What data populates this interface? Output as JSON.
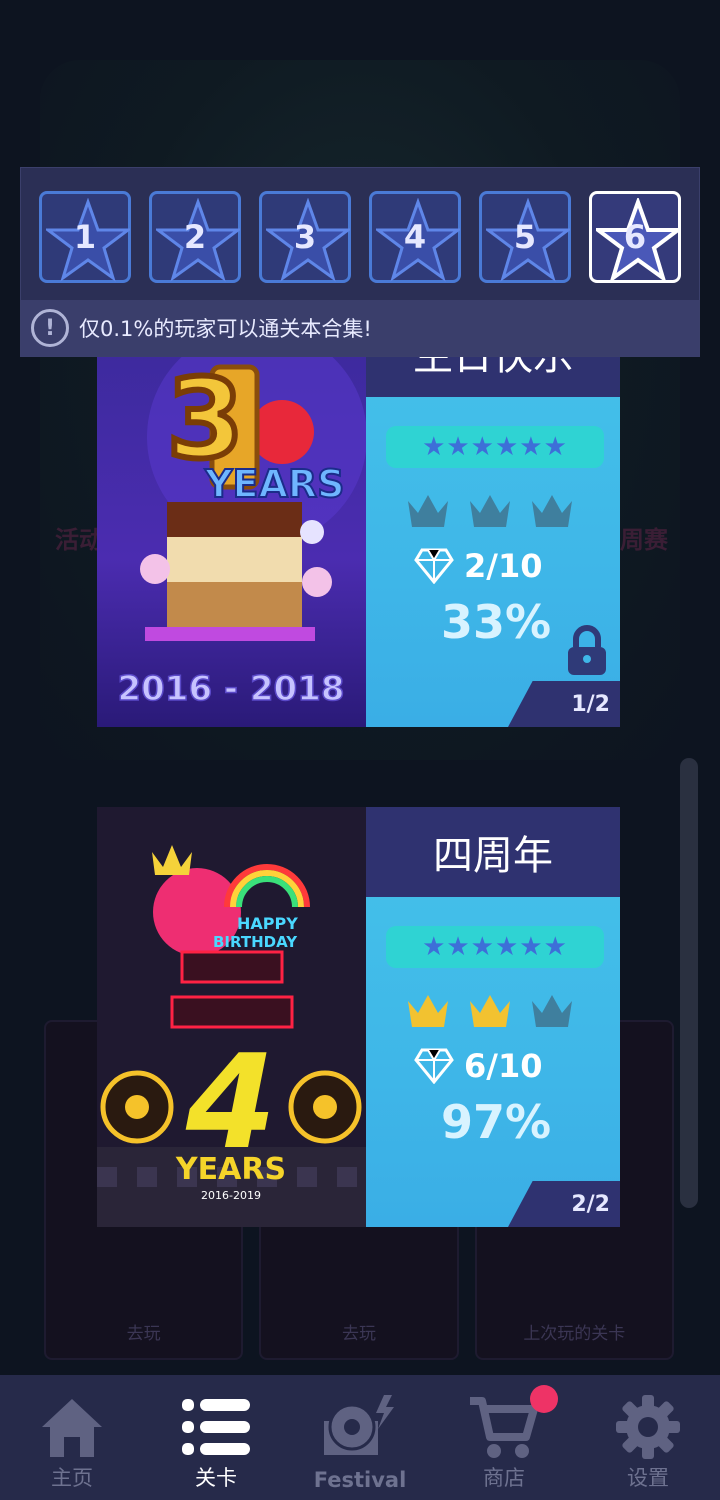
{
  "background": {
    "left_event_label": "活动",
    "right_event_label": "周赛",
    "cards": [
      {
        "button": "去玩"
      },
      {
        "button": "去玩"
      },
      {
        "button": "上次玩的关卡"
      }
    ]
  },
  "star_selector": {
    "levels": [
      "1",
      "2",
      "3",
      "4",
      "5",
      "6"
    ],
    "selected": "6",
    "notice": "仅0.1%的玩家可以通关本合集!"
  },
  "cards": [
    {
      "title": "生日快乐",
      "art_years_label": "YEARS",
      "art_big_number": "3",
      "art_date_range": "2016 - 2018",
      "stars": "★★★★★★",
      "crowns_earned": 0,
      "crowns_total": 3,
      "gems": "2/10",
      "percent": "33%",
      "locked": true,
      "page": "1/2"
    },
    {
      "title": "四周年",
      "art_birthday_label_1": "HAPPY",
      "art_birthday_label_2": "BIRTHDAY",
      "art_big_number": "4",
      "art_years_label": "YEARS",
      "art_date_range": "2016-2019",
      "stars": "★★★★★★",
      "crowns_earned": 2,
      "crowns_total": 3,
      "gems": "6/10",
      "percent": "97%",
      "locked": false,
      "page": "2/2"
    }
  ],
  "tabbar": {
    "items": [
      {
        "label": "主页",
        "icon": "home-icon"
      },
      {
        "label": "关卡",
        "icon": "list-icon"
      },
      {
        "label": "Festival",
        "icon": "record-icon"
      },
      {
        "label": "商店",
        "icon": "cart-icon"
      },
      {
        "label": "设置",
        "icon": "gear-icon"
      }
    ],
    "active": "关卡"
  },
  "colors": {
    "accent_crown": "#f2c230",
    "crown_inactive": "#3f7f9e",
    "notification": "#ee3366"
  }
}
